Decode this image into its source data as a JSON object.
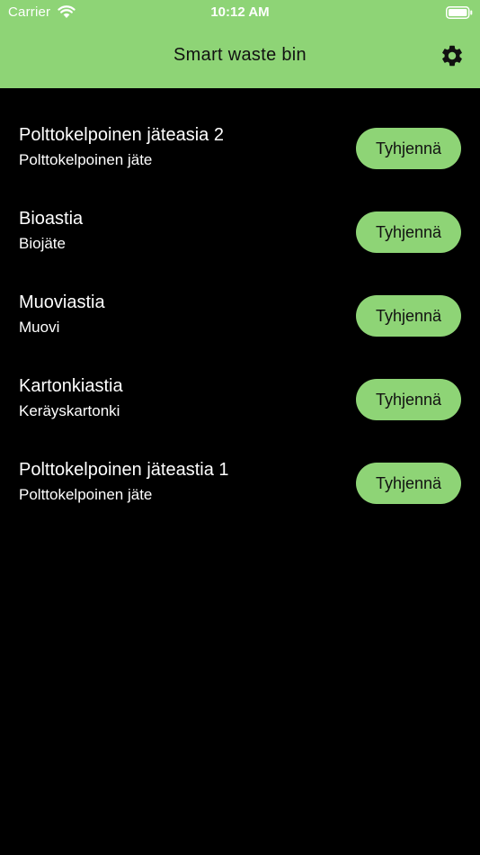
{
  "status_bar": {
    "carrier": "Carrier",
    "time": "10:12 AM",
    "wifi_icon": "wifi-icon",
    "battery_icon": "battery-full-icon"
  },
  "nav": {
    "title": "Smart waste bin",
    "settings_icon": "gear-icon"
  },
  "bins": [
    {
      "name": "Polttokelpoinen jäteasia 2",
      "type": "Polttokelpoinen jäte",
      "button": "Tyhjennä"
    },
    {
      "name": "Bioastia",
      "type": "Biojäte",
      "button": "Tyhjennä"
    },
    {
      "name": "Muoviastia",
      "type": "Muovi",
      "button": "Tyhjennä"
    },
    {
      "name": "Kartonkiastia",
      "type": "Keräyskartonki",
      "button": "Tyhjennä"
    },
    {
      "name": "Polttokelpoinen jäteastia 1",
      "type": "Polttokelpoinen jäte",
      "button": "Tyhjennä"
    }
  ],
  "colors": {
    "accent": "#8ed476",
    "background": "#000000",
    "text": "#ffffff"
  }
}
